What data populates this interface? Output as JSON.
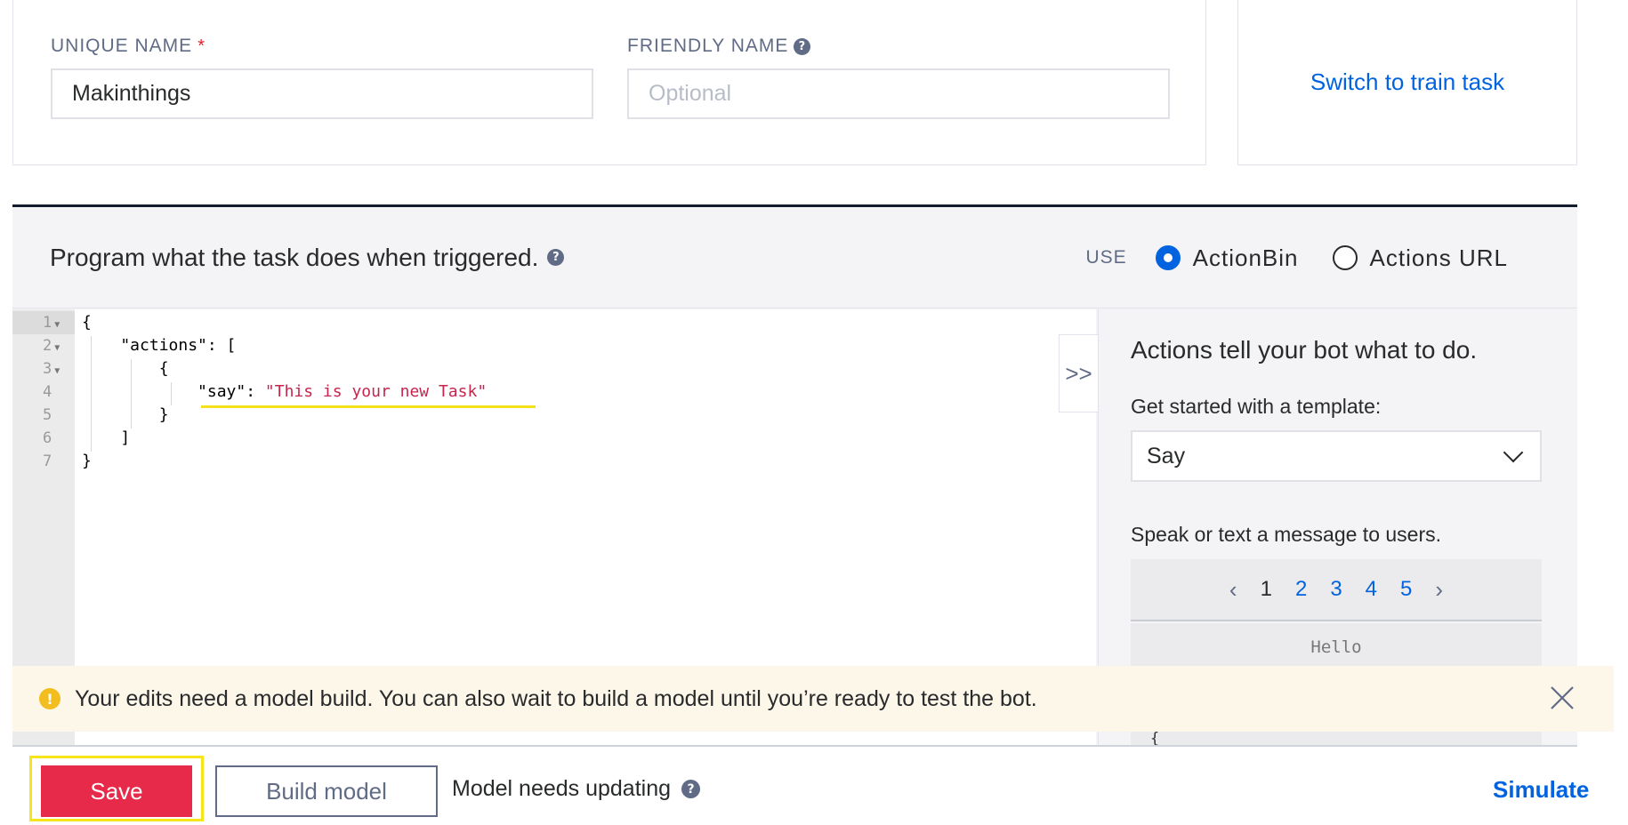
{
  "task_form": {
    "unique_name_label": "UNIQUE NAME",
    "required_marker": "*",
    "unique_name_value": "Makinthings",
    "friendly_name_label": "FRIENDLY NAME",
    "friendly_name_value": "",
    "friendly_name_placeholder": "Optional",
    "switch_link": "Switch to train task"
  },
  "program": {
    "title": "Program what the task does when triggered.",
    "use_label": "USE",
    "options": [
      {
        "label": "ActionBin",
        "selected": true
      },
      {
        "label": "Actions URL",
        "selected": false
      }
    ]
  },
  "editor": {
    "line_numbers": [
      "1",
      "2",
      "3",
      "4",
      "5",
      "6",
      "7"
    ],
    "lines": {
      "l1": "{",
      "l2": "    \"actions\": [",
      "l3": "        {",
      "l4_key": "            \"say\": ",
      "l4_value": "\"This is your new Task\"",
      "l5": "        }",
      "l6": "    ]",
      "l7": "}"
    }
  },
  "side_panel": {
    "expand_glyph": ">>",
    "title": "Actions tell your bot what to do.",
    "template_label": "Get started with a template:",
    "template_selected": "Say",
    "template_description": "Speak or text a message to users.",
    "pager": {
      "prev": "‹",
      "next": "›",
      "pages": [
        "1",
        "2",
        "3",
        "4",
        "5"
      ],
      "current": "1"
    },
    "preview_text": "Hello",
    "preview_code_start": "{"
  },
  "banner": {
    "icon_glyph": "!",
    "message": "Your edits need a model build. You can also wait to build a model until you’re ready to test the bot."
  },
  "footer": {
    "save_label": "Save",
    "build_label": "Build model",
    "status": "Model needs updating",
    "simulate_label": "Simulate"
  },
  "colors": {
    "accent_blue": "#0263e0",
    "save_red": "#e7294a",
    "highlight_yellow": "#f7e51c",
    "warning_bg": "#fdf7e9",
    "warning_icon": "#f2be1f",
    "code_string": "#c7254e"
  }
}
